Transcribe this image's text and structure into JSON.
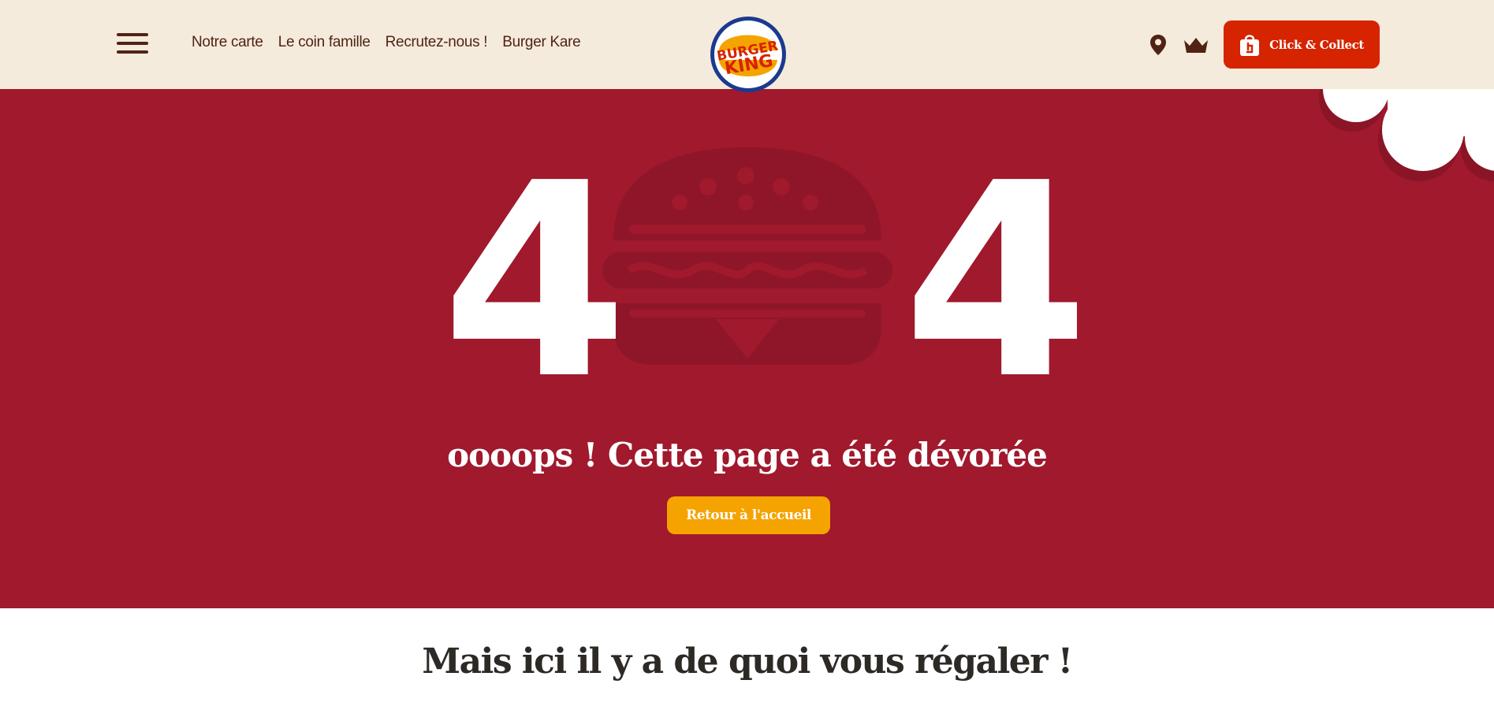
{
  "header": {
    "nav": [
      {
        "label": "Notre carte"
      },
      {
        "label": "Le coin famille"
      },
      {
        "label": "Recrutez-nous !"
      },
      {
        "label": "Burger Kare"
      }
    ],
    "logo": {
      "line1": "BURGER",
      "line2": "KING",
      "icon": "burger-king-logo"
    },
    "icons": {
      "menu": "hamburger-menu-icon",
      "location": "location-pin-icon",
      "rewards": "crown-icon",
      "bag": "shopping-bag-icon"
    },
    "cta_label": "Click & Collect"
  },
  "hero": {
    "digit_left": "4",
    "digit_right": "4",
    "headline": "oooops ! Cette page a été dévorée",
    "button_label": "Retour à l'accueil"
  },
  "section": {
    "title": "Mais ici il y a de quoi vous régaler !"
  },
  "colors": {
    "header_bg": "#f5ebdc",
    "brown": "#502314",
    "hero_bg": "#a0192d",
    "cta_red": "#d62300",
    "button_orange": "#f5a300"
  }
}
